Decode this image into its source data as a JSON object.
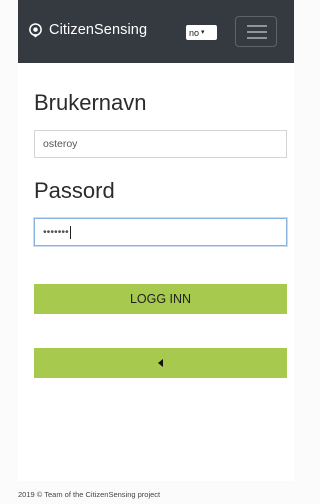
{
  "navbar": {
    "brand": "CitizenSensing",
    "language": "no"
  },
  "login": {
    "username_label": "Brukernavn",
    "username_value": "osteroy",
    "password_label": "Passord",
    "password_mask": "•••••••",
    "login_button": "LOGG INN"
  },
  "footer": {
    "text": "2019 © Team of the CitizenSensing project"
  },
  "colors": {
    "navbar": "#343a40",
    "button": "#a6c94e"
  },
  "icons": {
    "brand": "location-pin-icon",
    "back": "caret-left-icon",
    "menu": "hamburger-icon"
  }
}
